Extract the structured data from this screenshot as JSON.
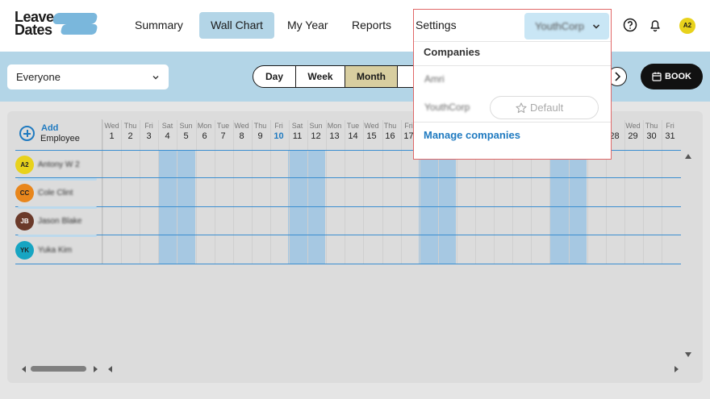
{
  "logo": {
    "line1": "Leave",
    "line2": "Dates"
  },
  "nav": [
    {
      "label": "Summary"
    },
    {
      "label": "Wall Chart",
      "active": true
    },
    {
      "label": "My Year"
    },
    {
      "label": "Reports"
    },
    {
      "label": "Settings"
    }
  ],
  "user": {
    "initials": "A2"
  },
  "icons": {
    "help": "help-circle-icon",
    "notifications": "bell-icon"
  },
  "filter": {
    "value": "Everyone"
  },
  "view_modes": [
    {
      "label": "Day"
    },
    {
      "label": "Week"
    },
    {
      "label": "Month",
      "selected": true
    }
  ],
  "book": {
    "label": "BOOK"
  },
  "add_employee": {
    "line1": "Add",
    "line2": "Employee"
  },
  "days": [
    {
      "dow": "Wed",
      "num": "1"
    },
    {
      "dow": "Thu",
      "num": "2"
    },
    {
      "dow": "Fri",
      "num": "3"
    },
    {
      "dow": "Sat",
      "num": "4"
    },
    {
      "dow": "Sun",
      "num": "5"
    },
    {
      "dow": "Mon",
      "num": "6"
    },
    {
      "dow": "Tue",
      "num": "7"
    },
    {
      "dow": "Wed",
      "num": "8"
    },
    {
      "dow": "Thu",
      "num": "9"
    },
    {
      "dow": "Fri",
      "num": "10",
      "today": true
    },
    {
      "dow": "Sat",
      "num": "11"
    },
    {
      "dow": "Sun",
      "num": "12"
    },
    {
      "dow": "Mon",
      "num": "13"
    },
    {
      "dow": "Tue",
      "num": "14"
    },
    {
      "dow": "Wed",
      "num": "15"
    },
    {
      "dow": "Thu",
      "num": "16"
    },
    {
      "dow": "Fri",
      "num": "17"
    },
    {
      "dow": "Wed",
      "num": "29"
    },
    {
      "dow": "Thu",
      "num": "30"
    },
    {
      "dow": "Fri",
      "num": "31"
    }
  ],
  "days_partial": [
    {
      "num": "28"
    }
  ],
  "employees": [
    {
      "initials": "A2",
      "name": "Antony W 2",
      "color": "#e8d21c"
    },
    {
      "initials": "CC",
      "name": "Cole Clint",
      "color": "#e8861c"
    },
    {
      "initials": "JB",
      "name": "Jason Blake",
      "color": "#6b3a2a"
    },
    {
      "initials": "YK",
      "name": "Yuka Kim",
      "color": "#17a5c2"
    }
  ],
  "dropdown": {
    "settings_label": "Settings",
    "current_company": "YouthCorp",
    "section_title": "Companies",
    "companies": [
      {
        "name": "Amri"
      },
      {
        "name": "YouthCorp",
        "action": "Default"
      }
    ],
    "manage_label": "Manage companies"
  },
  "colors": {
    "accent": "#1f7ac0",
    "band": "#b3d5e7",
    "weekend": "#a6c8e2",
    "selected_mode": "#d8cea0"
  }
}
